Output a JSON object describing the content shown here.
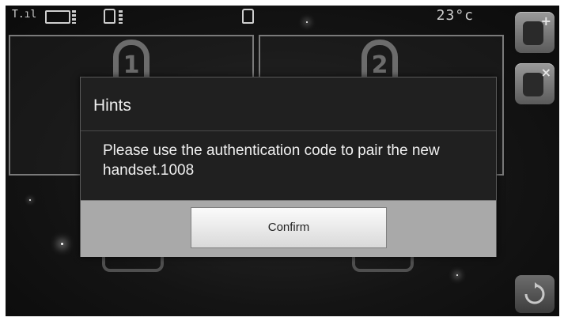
{
  "status_bar": {
    "signal_label": "T.ıl",
    "temperature": "23°c",
    "handset_slots": [
      "1",
      "2"
    ]
  },
  "dialog": {
    "title": "Hints",
    "message": "Please use the authentication code to pair the new handset.1008",
    "confirm_label": "Confirm"
  },
  "side_buttons": {
    "add_icon": "handset-add-icon",
    "remove_icon": "handset-remove-icon",
    "refresh_icon": "refresh-icon"
  }
}
